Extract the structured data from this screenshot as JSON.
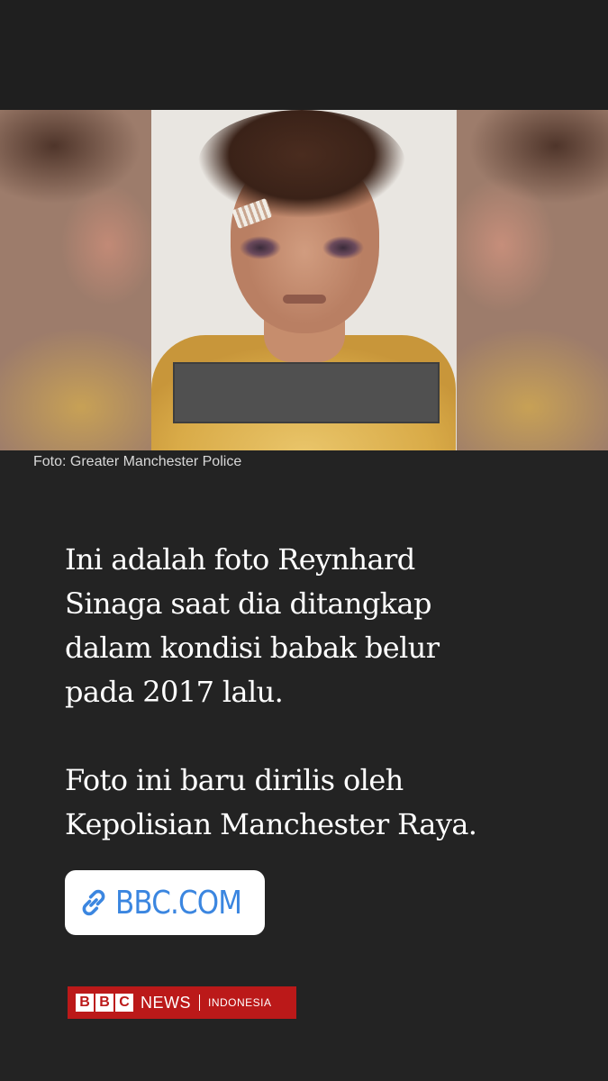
{
  "photo": {
    "caption": "Foto: Greater Manchester Police"
  },
  "story": {
    "paragraph_1": "Ini adalah foto Reynhard\nSinaga saat dia ditangkap\ndalam kondisi babak belur\npada 2017 lalu.",
    "paragraph_2": "Foto ini baru dirilis oleh\nKepolisian Manchester Raya."
  },
  "link_sticker": {
    "label": "BBC.COM",
    "icon": "link-icon",
    "color": "#3b86e0"
  },
  "branding": {
    "blocks": [
      "B",
      "B",
      "C"
    ],
    "news": "NEWS",
    "edition": "INDONESIA",
    "color": "#bb1919"
  }
}
